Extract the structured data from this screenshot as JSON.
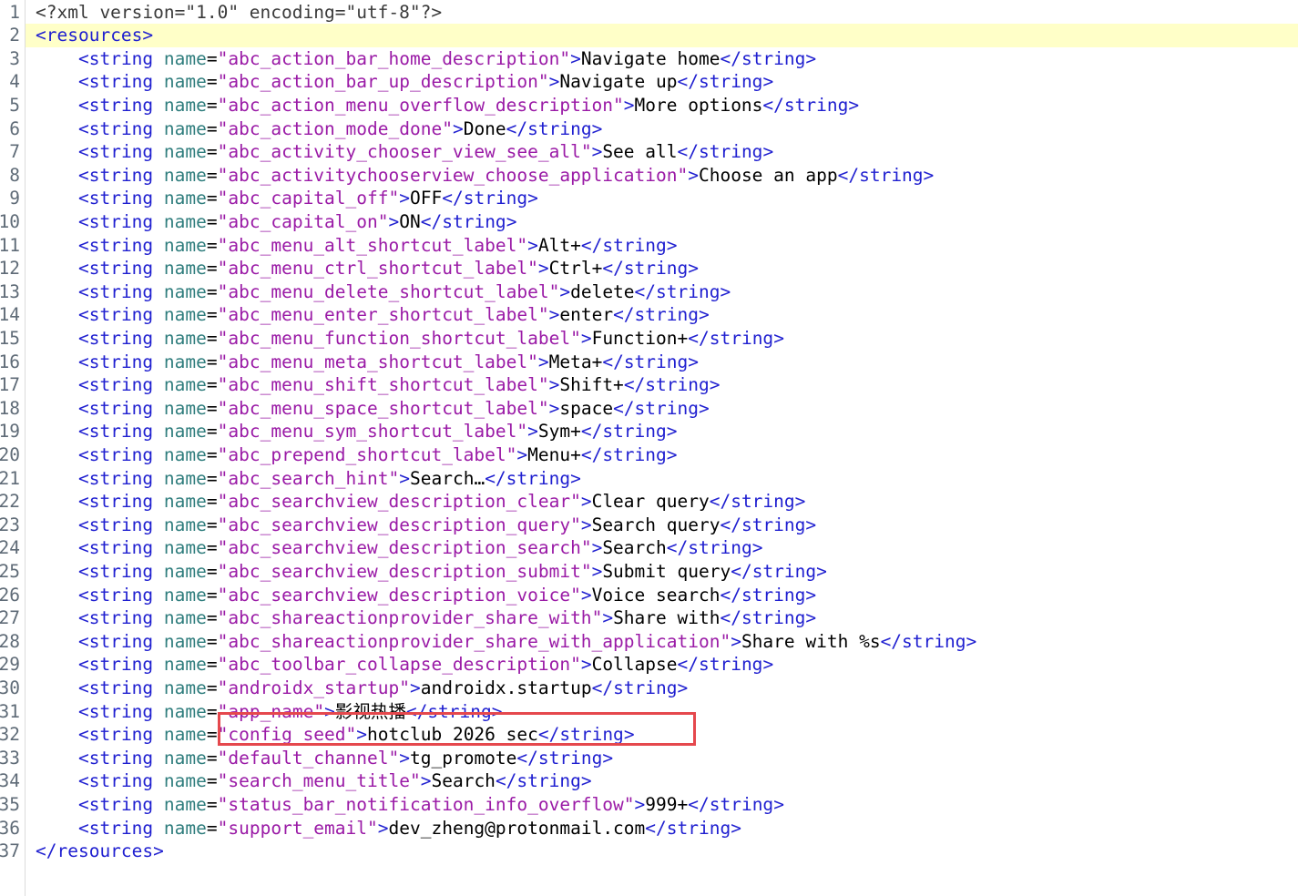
{
  "editor": {
    "current_line": 2,
    "highlight_color": "#e5484d",
    "colors": {
      "tag": "#1f1fd0",
      "attribute": "#2f7d7d",
      "value": "#9a1aa6",
      "text": "#000000",
      "current_line_bg": "#ffffc8"
    },
    "lines": [
      {
        "n": "1",
        "kind": "decl",
        "text": "<?xml version=\"1.0\" encoding=\"utf-8\"?>"
      },
      {
        "n": "2",
        "kind": "open",
        "tag": "resources"
      },
      {
        "n": "3",
        "kind": "string",
        "name": "abc_action_bar_home_description",
        "value": "Navigate home"
      },
      {
        "n": "4",
        "kind": "string",
        "name": "abc_action_bar_up_description",
        "value": "Navigate up"
      },
      {
        "n": "5",
        "kind": "string",
        "name": "abc_action_menu_overflow_description",
        "value": "More options"
      },
      {
        "n": "6",
        "kind": "string",
        "name": "abc_action_mode_done",
        "value": "Done"
      },
      {
        "n": "7",
        "kind": "string",
        "name": "abc_activity_chooser_view_see_all",
        "value": "See all"
      },
      {
        "n": "8",
        "kind": "string",
        "name": "abc_activitychooserview_choose_application",
        "value": "Choose an app"
      },
      {
        "n": "9",
        "kind": "string",
        "name": "abc_capital_off",
        "value": "OFF"
      },
      {
        "n": "10",
        "kind": "string",
        "name": "abc_capital_on",
        "value": "ON"
      },
      {
        "n": "11",
        "kind": "string",
        "name": "abc_menu_alt_shortcut_label",
        "value": "Alt+"
      },
      {
        "n": "12",
        "kind": "string",
        "name": "abc_menu_ctrl_shortcut_label",
        "value": "Ctrl+"
      },
      {
        "n": "13",
        "kind": "string",
        "name": "abc_menu_delete_shortcut_label",
        "value": "delete"
      },
      {
        "n": "14",
        "kind": "string",
        "name": "abc_menu_enter_shortcut_label",
        "value": "enter"
      },
      {
        "n": "15",
        "kind": "string",
        "name": "abc_menu_function_shortcut_label",
        "value": "Function+"
      },
      {
        "n": "16",
        "kind": "string",
        "name": "abc_menu_meta_shortcut_label",
        "value": "Meta+"
      },
      {
        "n": "17",
        "kind": "string",
        "name": "abc_menu_shift_shortcut_label",
        "value": "Shift+"
      },
      {
        "n": "18",
        "kind": "string",
        "name": "abc_menu_space_shortcut_label",
        "value": "space"
      },
      {
        "n": "19",
        "kind": "string",
        "name": "abc_menu_sym_shortcut_label",
        "value": "Sym+"
      },
      {
        "n": "20",
        "kind": "string",
        "name": "abc_prepend_shortcut_label",
        "value": "Menu+"
      },
      {
        "n": "21",
        "kind": "string",
        "name": "abc_search_hint",
        "value": "Search…"
      },
      {
        "n": "22",
        "kind": "string",
        "name": "abc_searchview_description_clear",
        "value": "Clear query"
      },
      {
        "n": "23",
        "kind": "string",
        "name": "abc_searchview_description_query",
        "value": "Search query"
      },
      {
        "n": "24",
        "kind": "string",
        "name": "abc_searchview_description_search",
        "value": "Search"
      },
      {
        "n": "25",
        "kind": "string",
        "name": "abc_searchview_description_submit",
        "value": "Submit query"
      },
      {
        "n": "26",
        "kind": "string",
        "name": "abc_searchview_description_voice",
        "value": "Voice search"
      },
      {
        "n": "27",
        "kind": "string",
        "name": "abc_shareactionprovider_share_with",
        "value": "Share with"
      },
      {
        "n": "28",
        "kind": "string",
        "name": "abc_shareactionprovider_share_with_application",
        "value": "Share with %s"
      },
      {
        "n": "29",
        "kind": "string",
        "name": "abc_toolbar_collapse_description",
        "value": "Collapse"
      },
      {
        "n": "30",
        "kind": "string",
        "name": "androidx_startup",
        "value": "androidx.startup"
      },
      {
        "n": "31",
        "kind": "string",
        "name": "app_name",
        "value": "影视热播"
      },
      {
        "n": "32",
        "kind": "string",
        "name": "config_seed",
        "value": "hotclub_2026_sec"
      },
      {
        "n": "33",
        "kind": "string",
        "name": "default_channel",
        "value": "tg_promote"
      },
      {
        "n": "34",
        "kind": "string",
        "name": "search_menu_title",
        "value": "Search"
      },
      {
        "n": "35",
        "kind": "string",
        "name": "status_bar_notification_info_overflow",
        "value": "999+"
      },
      {
        "n": "36",
        "kind": "string",
        "name": "support_email",
        "value": "dev_zheng@protonmail.com"
      },
      {
        "n": "37",
        "kind": "close",
        "tag": "resources"
      }
    ]
  }
}
